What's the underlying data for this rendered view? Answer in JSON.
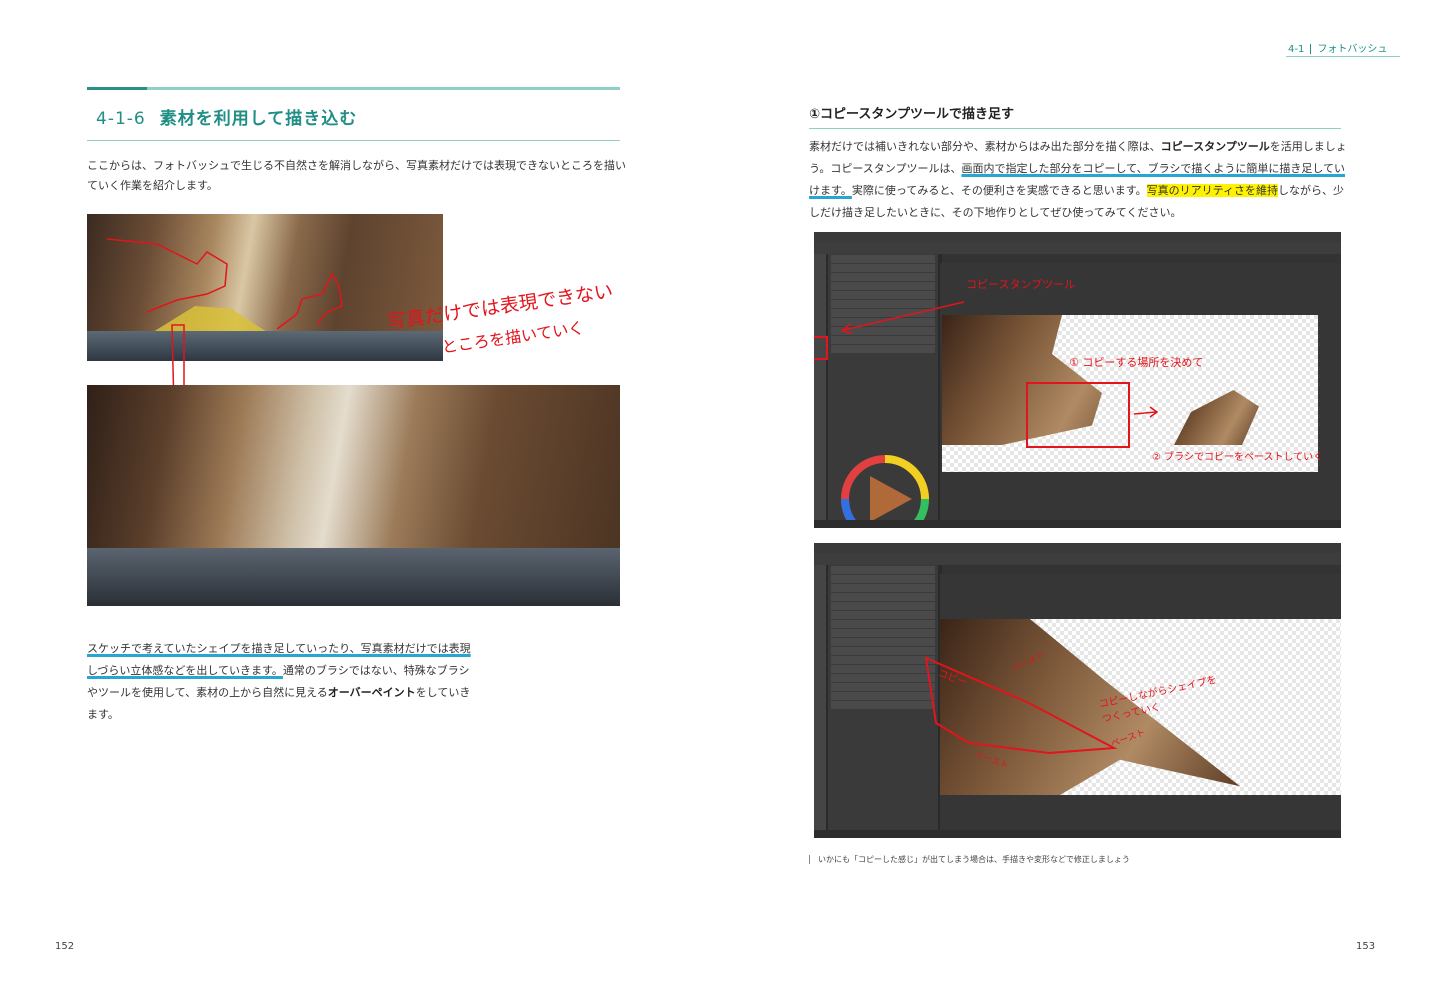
{
  "left_page": {
    "section_number": "4-1-6",
    "section_title": "素材を利用して描き込む",
    "intro": "ここからは、フォトバッシュで生じる不自然さを解消しながら、写真素材だけでは表現できないところを描いていく作業を紹介します。",
    "image_annotation_line1": "写真だけでは表現できない",
    "image_annotation_line2": "ところを描いていく",
    "body_underlined": "スケッチで考えていたシェイプを描き足していったり、写真素材だけでは表現しづらい立体感などを出していきます。",
    "body_rest_1": "通常のブラシではない、特殊なブラシやツールを使用して、素材の上から自然に見える",
    "body_bold": "オーバーペイント",
    "body_rest_2": "をしていきます。",
    "page_number": "152"
  },
  "right_page": {
    "header_section": "4-1",
    "header_title": "フォトバッシュ",
    "subheading": "①コピースタンプツールで描き足す",
    "body_1": "素材だけでは補いきれない部分や、素材からはみ出た部分を描く際は、",
    "body_bold_1": "コピースタンプツール",
    "body_2": "を活用しましょう。コピースタンプツールは、",
    "body_underlined": "画面内で指定した部分をコピーして、ブラシで描くように簡単に描き足していけます。",
    "body_3": "実際に使ってみると、その便利さを実感できると思います。",
    "body_highlight": "写真のリアリティさを維持",
    "body_4": "しながら、少しだけ描き足したいときに、その下地作りとしてぜひ使ってみてください。",
    "screenshot1": {
      "note_tool": "コピースタンプツール",
      "note_step1": "① コピーする場所を決めて",
      "note_step2": "② ブラシでコピーをペーストしていく"
    },
    "screenshot2": {
      "note_copy": "コピー",
      "note_paste1": "ペースト",
      "note_paste2": "ペースト",
      "note_paste3": "ペースト",
      "note_shape": "コピーしながらシェイプをつくっていく"
    },
    "caption": "いかにも「コピーした感じ」が出てしまう場合は、手描きや変形などで修正しましょう",
    "page_number": "153"
  },
  "colors": {
    "accent": "#1f8f86",
    "annotation_red": "#e3141c",
    "underline_blue": "#27a6d6",
    "highlight_yellow": "#fff200"
  }
}
